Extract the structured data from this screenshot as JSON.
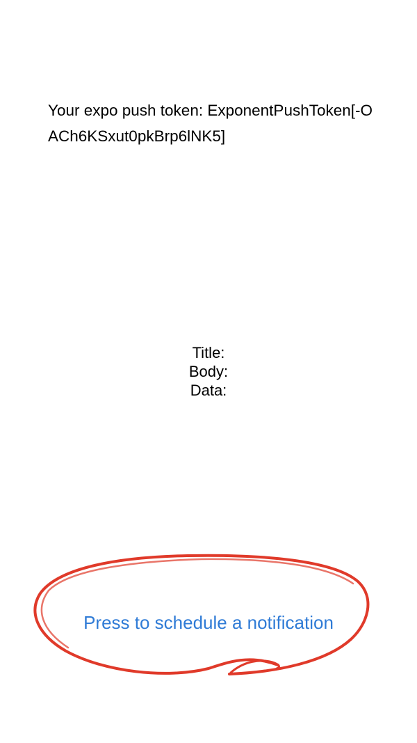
{
  "token": {
    "label": "Your expo push token:",
    "value": "ExponentPushToken[-OACh6KSxut0pkBrp6lNK5]"
  },
  "notification": {
    "title_label": "Title:",
    "body_label": "Body:",
    "data_label": "Data:"
  },
  "schedule_button": {
    "label": "Press to schedule a notification"
  },
  "colors": {
    "link": "#2f7bd6",
    "annotation": "#e03a2a",
    "text": "#000000",
    "background": "#ffffff"
  },
  "annotation": {
    "shape": "hand-drawn circle around schedule button"
  }
}
